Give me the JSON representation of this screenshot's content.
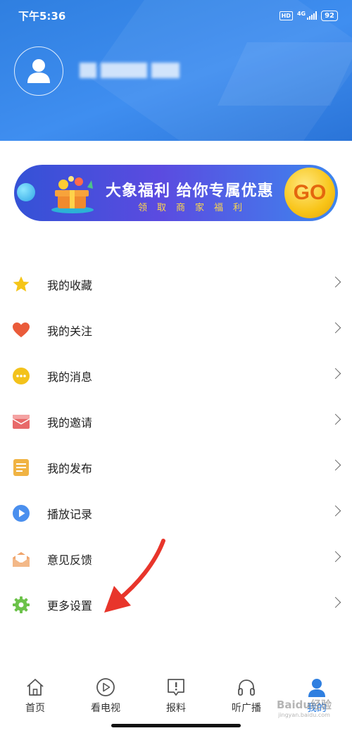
{
  "status_bar": {
    "time": "下午5:36",
    "hd": "HD",
    "network": "4G",
    "battery": "92"
  },
  "profile": {
    "avatar": "person-icon"
  },
  "banner": {
    "title": "大象福利 给你专属优惠",
    "subtitle": "领取商家福利",
    "cta": "GO"
  },
  "menu": [
    {
      "label": "我的收藏",
      "icon": "star-icon",
      "color": "#f5c518"
    },
    {
      "label": "我的关注",
      "icon": "heart-icon",
      "color": "#ea5b3a"
    },
    {
      "label": "我的消息",
      "icon": "chat-bubble-icon",
      "color": "#f3c21b"
    },
    {
      "label": "我的邀请",
      "icon": "envelope-icon",
      "color": "#e86a6a"
    },
    {
      "label": "我的发布",
      "icon": "document-icon",
      "color": "#f0b343"
    },
    {
      "label": "播放记录",
      "icon": "play-icon",
      "color": "#4a8fee"
    },
    {
      "label": "意见反馈",
      "icon": "open-mail-icon",
      "color": "#f0a46a"
    },
    {
      "label": "更多设置",
      "icon": "gear-icon",
      "color": "#6cc24a"
    }
  ],
  "tabs": [
    {
      "label": "首页",
      "icon": "home-icon",
      "active": false
    },
    {
      "label": "看电视",
      "icon": "play-circle-icon",
      "active": false
    },
    {
      "label": "报料",
      "icon": "report-icon",
      "active": false
    },
    {
      "label": "听广播",
      "icon": "headphones-icon",
      "active": false
    },
    {
      "label": "我的",
      "icon": "user-icon",
      "active": true
    }
  ],
  "colors": {
    "header": "#3a88ec",
    "accent": "#2f7fe0",
    "arrow": "#e8352b"
  },
  "watermark": {
    "brand": "Baidu经验",
    "url": "jingyan.baidu.com"
  }
}
